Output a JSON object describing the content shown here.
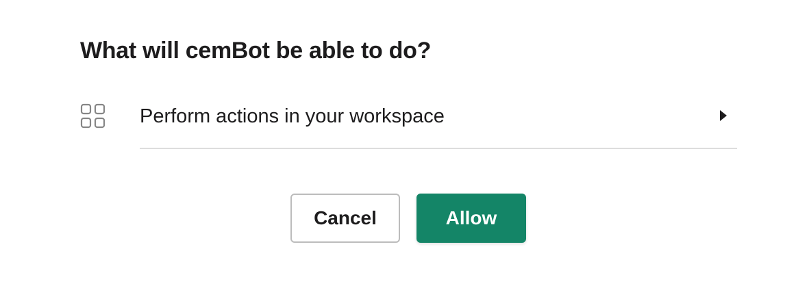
{
  "dialog": {
    "title": "What will cemBot be able to do?",
    "permissions": [
      {
        "icon": "grid-icon",
        "label": "Perform actions in your workspace",
        "expand_icon": "caret-right-icon"
      }
    ],
    "buttons": {
      "cancel_label": "Cancel",
      "allow_label": "Allow"
    },
    "colors": {
      "allow_bg": "#148567",
      "text": "#1d1c1d",
      "divider": "#dddddd",
      "cancel_border": "#bcbcbc"
    }
  }
}
